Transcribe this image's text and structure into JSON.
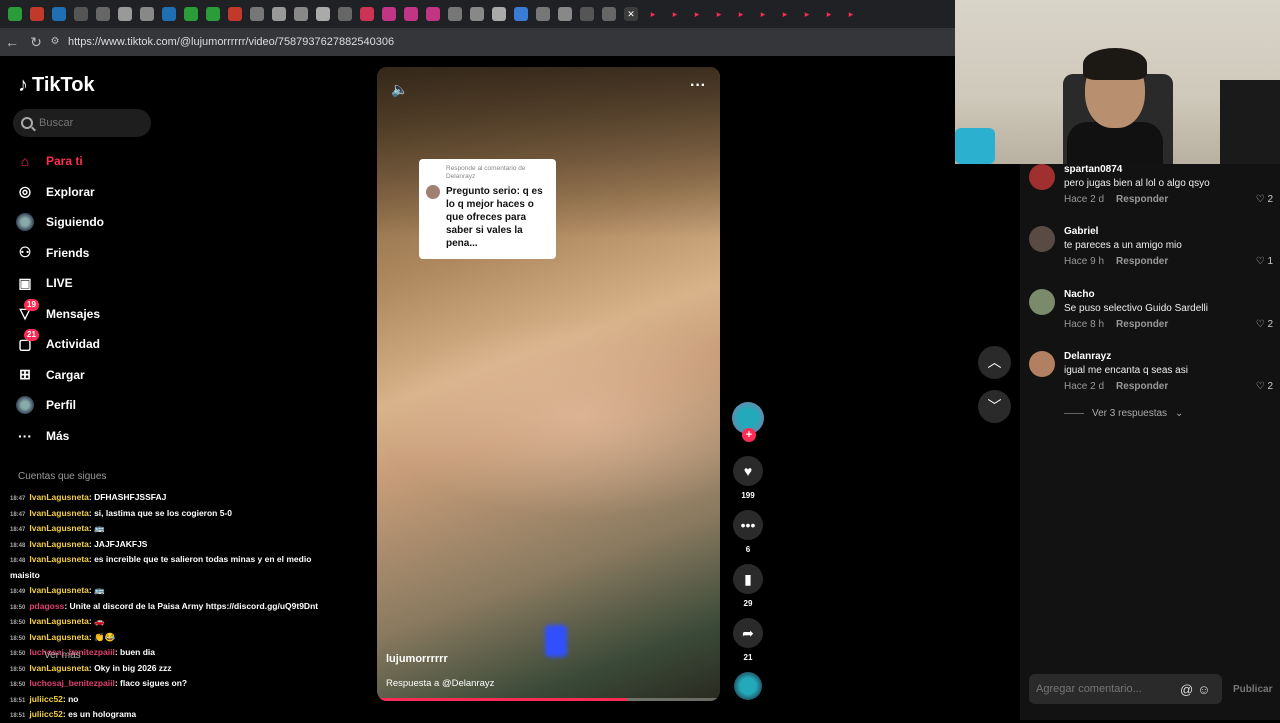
{
  "browser": {
    "url": "https://www.tiktok.com/@lujumorrrrrr/video/7587937627882540306"
  },
  "sidebar": {
    "logo": "TikTok",
    "search_placeholder": "Buscar",
    "items": [
      {
        "label": "Para ti",
        "icon": "home-icon",
        "active": true
      },
      {
        "label": "Explorar",
        "icon": "compass-icon"
      },
      {
        "label": "Siguiendo",
        "icon": "following-avatar-icon"
      },
      {
        "label": "Friends",
        "icon": "friends-icon"
      },
      {
        "label": "LIVE",
        "icon": "live-icon"
      },
      {
        "label": "Mensajes",
        "icon": "messages-icon",
        "badge": "19"
      },
      {
        "label": "Actividad",
        "icon": "activity-icon",
        "badge": "21"
      },
      {
        "label": "Cargar",
        "icon": "upload-icon"
      },
      {
        "label": "Perfil",
        "icon": "profile-avatar-icon"
      },
      {
        "label": "Más",
        "icon": "more-icon"
      }
    ],
    "follows_title": "Cuentas que sigues",
    "see_more": "Ver más"
  },
  "chat": [
    {
      "time": "18:47",
      "user": "IvanLagusneta",
      "text": ": DFHASHFJSSFAJ",
      "color": "yellow"
    },
    {
      "time": "18:47",
      "user": "IvanLagusneta",
      "text": ": si, lastima que se los cogieron 5-0",
      "color": "yellow"
    },
    {
      "time": "18:47",
      "user": "IvanLagusneta",
      "text": ": 🚌",
      "color": "yellow"
    },
    {
      "time": "18:48",
      "user": "IvanLagusneta",
      "text": ": JAJFJAKFJS",
      "color": "yellow"
    },
    {
      "time": "18:48",
      "user": "IvanLagusneta",
      "text": ": es increible que te salieron todas minas y en el medio",
      "color": "yellow"
    },
    {
      "time": "",
      "user": "",
      "text": "maisito",
      "color": "yellow"
    },
    {
      "time": "18:49",
      "user": "IvanLagusneta",
      "text": ": 🚌",
      "color": "yellow"
    },
    {
      "time": "18:50",
      "user": "pdagoss",
      "text": ": Unite al discord de la Paisa Army https://discord.gg/uQ9t9Dnt",
      "color": "pink"
    },
    {
      "time": "18:50",
      "user": "IvanLagusneta",
      "text": ": 🚗",
      "color": "yellow"
    },
    {
      "time": "18:50",
      "user": "IvanLagusneta",
      "text": ": 👏😂",
      "color": "yellow"
    },
    {
      "time": "18:50",
      "user": "luchosaj_benitezpaiil",
      "text": ": buen dia",
      "color": "pink"
    },
    {
      "time": "18:50",
      "user": "IvanLagusneta",
      "text": ": Oky in big 2026 zzz",
      "color": "yellow"
    },
    {
      "time": "18:50",
      "user": "luchosaj_benitezpaiil",
      "text": ": flaco sigues on?",
      "color": "pink"
    },
    {
      "time": "18:51",
      "user": "juliicc52",
      "text": ": no",
      "color": "yellow"
    },
    {
      "time": "18:51",
      "user": "juliicc52",
      "text": ": es un holograma",
      "color": "yellow"
    }
  ],
  "video": {
    "reply_header": "Responde al comentario de Delanrayz",
    "reply_text": "Pregunto serio: q es lo q mejor haces o que ofreces para saber si vales la pena...",
    "author": "lujumorrrrrr",
    "caption": "Respuesta a @Delanrayz",
    "progress": 0.73
  },
  "actions": {
    "likes": "199",
    "comments": "6",
    "saves": "29",
    "shares": "21"
  },
  "comments": [
    {
      "user": "spartan0874",
      "text": "pero jugas bien al lol o algo qsyo",
      "time": "Hace 2 d",
      "reply": "Responder",
      "likes": "2",
      "avatar_color": "#a03030"
    },
    {
      "user": "Gabriel",
      "text": "te pareces a un amigo mio",
      "time": "Hace 9 h",
      "reply": "Responder",
      "likes": "1",
      "avatar_color": "#5a4a44"
    },
    {
      "user": "Nacho",
      "text": "Se puso selectivo Guido Sardelli",
      "time": "Hace 8 h",
      "reply": "Responder",
      "likes": "2",
      "avatar_color": "#7a8a6a"
    },
    {
      "user": "Delanrayz",
      "text": "igual me encanta q seas asi",
      "time": "Hace 2 d",
      "reply": "Responder",
      "likes": "2",
      "avatar_color": "#b08060"
    }
  ],
  "see_replies": "Ver 3 respuestas",
  "comment_input": {
    "placeholder": "Agregar comentario...",
    "publish": "Publicar"
  }
}
